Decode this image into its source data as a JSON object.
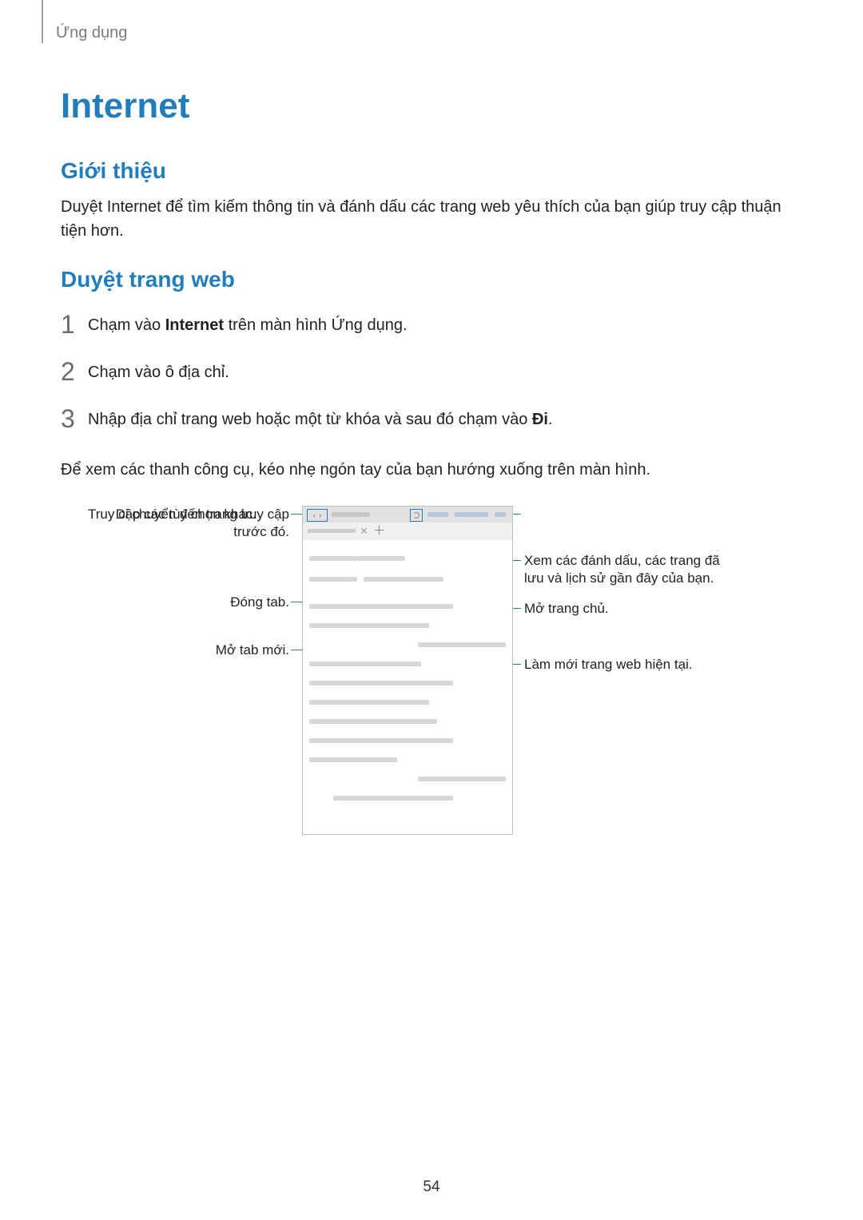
{
  "header_label": "Ứng dụng",
  "title": "Internet",
  "intro_heading": "Giới thiệu",
  "intro_text": "Duyệt Internet để tìm kiếm thông tin và đánh dấu các trang web yêu thích của bạn giúp truy cập thuận tiện hơn.",
  "browse_heading": "Duyệt trang web",
  "steps": [
    {
      "num": "1",
      "pre": "Chạm vào ",
      "bold": "Internet",
      "post": " trên màn hình Ứng dụng."
    },
    {
      "num": "2",
      "pre": "Chạm vào ô địa chỉ.",
      "bold": "",
      "post": ""
    },
    {
      "num": "3",
      "pre": "Nhập địa chỉ trang web hoặc một từ khóa và sau đó chạm vào ",
      "bold": "Đi",
      "post": "."
    }
  ],
  "note": "Để xem các thanh công cụ, kéo nhẹ ngón tay của bạn hướng xuống trên màn hình.",
  "callouts": {
    "left1": "Di chuyển đến trang truy cập trước đó.",
    "left2": "Đóng tab.",
    "left3": "Mở tab mới.",
    "right1": "Truy cập các tùy chọn khác.",
    "right2": "Xem các đánh dấu, các trang đã lưu và lịch sử gần đây của bạn.",
    "right3": "Mở trang chủ.",
    "right4": "Làm mới trang web hiện tại."
  },
  "page_number": "54"
}
